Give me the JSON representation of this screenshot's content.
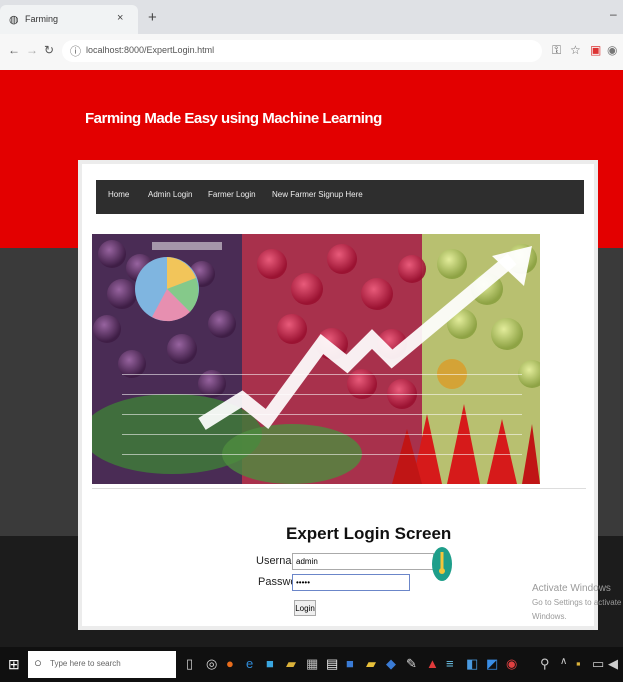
{
  "browser": {
    "tab_title": "Farming",
    "url": "localhost:8000/ExpertLogin.html",
    "new_tab": "+",
    "close": "×",
    "minimize": "–"
  },
  "site": {
    "title": "Farming Made Easy using Machine Learning"
  },
  "nav": {
    "items": [
      "Home",
      "Admin Login",
      "Farmer Login",
      "New Farmer Signup Here"
    ]
  },
  "login": {
    "title": "Expert Login Screen",
    "username_label": "Username",
    "username_value": "admin",
    "password_label": "Password",
    "password_value": "•••••",
    "button_label": "Login"
  },
  "watermark": {
    "line1": "Activate Windows",
    "line2": "Go to Settings to activate Windows."
  },
  "taskbar": {
    "search_placeholder": "Type here to search"
  },
  "colors": {
    "header_red": "#e30000",
    "navbar": "#2e2e2e",
    "pin": "#1e9e8a"
  }
}
